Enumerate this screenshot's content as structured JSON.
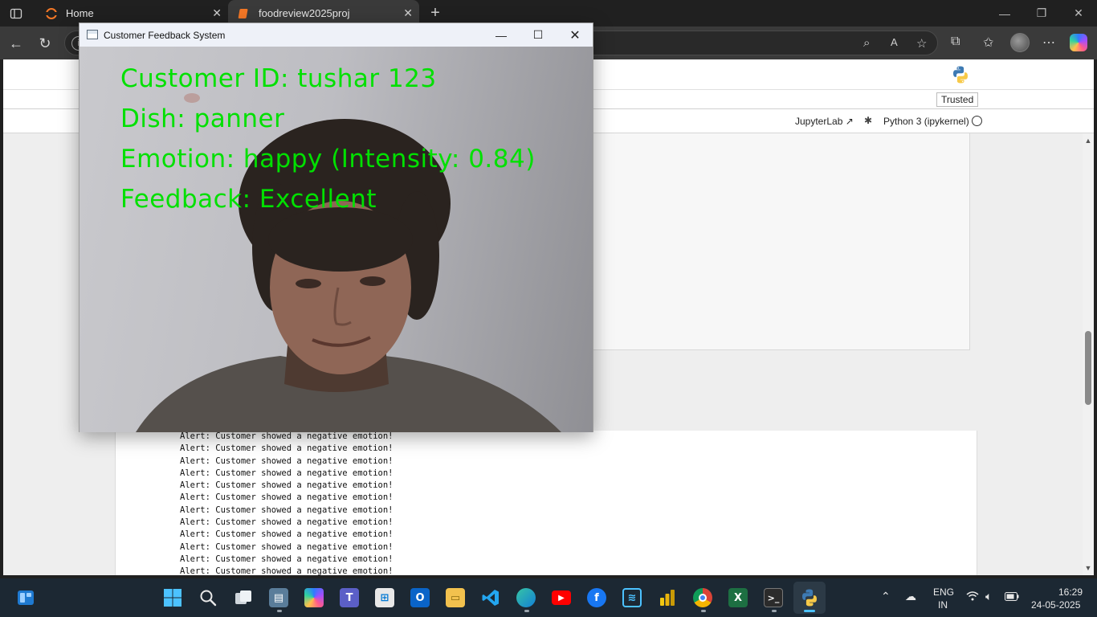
{
  "browser": {
    "tabs": [
      {
        "title": "Home",
        "active": false
      },
      {
        "title": "foodreview2025proj",
        "active": true
      }
    ]
  },
  "jupyter": {
    "trusted_label": "Trusted",
    "jupyterlab_link": "JupyterLab",
    "kernel_name": "Python 3 (ipykernel)"
  },
  "output": {
    "lines": [
      "Alert: Customer showed a negative emotion!",
      "Alert: Customer showed a negative emotion!",
      "Alert: Customer showed a negative emotion!",
      "Alert: Customer showed a negative emotion!",
      "Alert: Customer showed a negative emotion!",
      "Alert: Customer showed a negative emotion!",
      "Alert: Customer showed a negative emotion!",
      "Alert: Customer showed a negative emotion!",
      "Alert: Customer showed a negative emotion!",
      "Alert: Customer showed a negative emotion!",
      "Alert: Customer showed a negative emotion!",
      "Alert: Customer showed a negative emotion!"
    ]
  },
  "cv_window": {
    "title": "Customer Feedback System",
    "overlay": {
      "customer_id": "Customer ID: tushar 123",
      "dish": "Dish: panner",
      "emotion": "Emotion: happy (Intensity: 0.84)",
      "feedback": "Feedback: Excellent"
    },
    "overlay_color": "#00e000"
  },
  "taskbar": {
    "language": "ENG",
    "region": "IN",
    "time": "16:29",
    "date": "24-05-2025",
    "apps": [
      "start",
      "search",
      "task-view",
      "file-explorer-alt",
      "copilot",
      "teams",
      "store",
      "outlook",
      "file-explorer",
      "vscode",
      "edge",
      "youtube",
      "facebook",
      "azure-data-studio",
      "power-bi",
      "chrome",
      "excel",
      "terminal",
      "python"
    ]
  },
  "colors": {
    "accent_green": "#00e000",
    "taskbar_bg": "#1c2833",
    "browser_chrome": "#202020"
  }
}
